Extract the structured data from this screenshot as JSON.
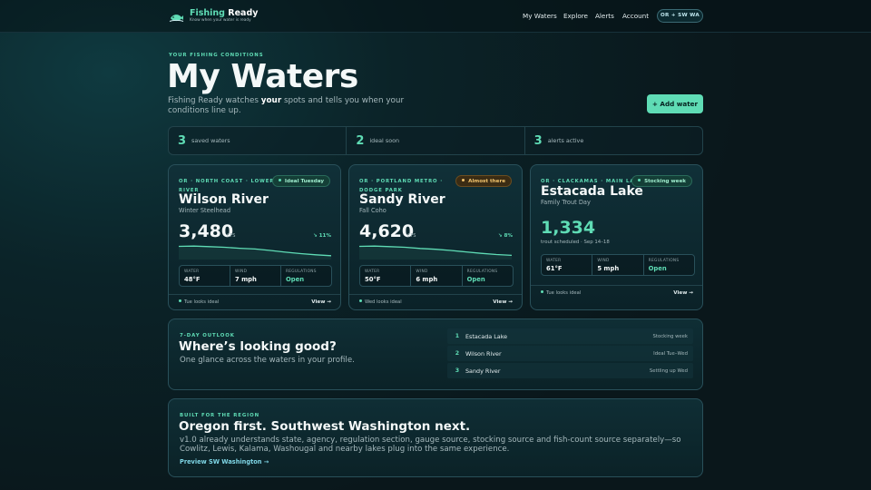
{
  "brand": {
    "name_a": "Fishing",
    "name_b": " Ready",
    "tagline": "Know when your water is ready",
    "icon": "fish-hook-logo"
  },
  "nav": {
    "items": [
      "My Waters",
      "Explore",
      "Alerts",
      "Account"
    ],
    "region_button": "OR + SW WA"
  },
  "hero": {
    "eyebrow": "YOUR FISHING CONDITIONS",
    "title": "My Waters",
    "sub_before": "Fishing Ready watches ",
    "sub_bold": "your",
    "sub_after": " spots and tells you when your conditions line up.",
    "add_button": "+ Add water"
  },
  "stats": [
    {
      "num": "3",
      "label": "saved waters"
    },
    {
      "num": "2",
      "label": "ideal soon"
    },
    {
      "num": "3",
      "label": "alerts active"
    }
  ],
  "cards": [
    {
      "location": "OR · NORTH COAST · LOWER RIVER",
      "badge": "Ideal Tuesday",
      "river": "Wilson River",
      "species": "Winter Steelhead",
      "flow": "3,480",
      "unit": "CFS",
      "change": "↘ 11%",
      "trend": [
        0.22,
        0.2,
        0.24,
        0.28,
        0.35,
        0.4,
        0.5,
        0.62,
        0.72,
        0.8,
        0.86
      ],
      "water_label": "WATER",
      "water": "48°F",
      "wind_label": "WIND",
      "wind": "7 mph",
      "reg_label": "REGULATIONS",
      "reg": "Open",
      "foot": "Tue looks ideal",
      "view": "View →"
    },
    {
      "location": "OR · PORTLAND METRO · DODGE PARK",
      "badge": "Almost there",
      "river": "Sandy River",
      "species": "Fall Coho",
      "flow": "4,620",
      "unit": "CFS",
      "change": "↘ 8%",
      "trend": [
        0.22,
        0.2,
        0.24,
        0.28,
        0.36,
        0.42,
        0.5,
        0.6,
        0.7,
        0.78,
        0.84
      ],
      "water_label": "WATER",
      "water": "50°F",
      "wind_label": "WIND",
      "wind": "6 mph",
      "reg_label": "REGULATIONS",
      "reg": "Open",
      "foot": "Wed looks ideal",
      "view": "View →"
    },
    {
      "location": "OR · CLACKAMAS · MAIN LAKE",
      "badge": "Stocking week",
      "river": "Estacada Lake",
      "species": "Family Trout Day",
      "count": "1,334",
      "schedule": "trout scheduled · Sep 14–18",
      "water_label": "WATER",
      "water": "61°F",
      "wind_label": "WIND",
      "wind": "5 mph",
      "reg_label": "REGULATIONS",
      "reg": "Open",
      "foot": "Tue looks ideal",
      "view": "View →"
    }
  ],
  "outlook": {
    "eyebrow": "7-DAY OUTLOOK",
    "title": "Where’s looking good?",
    "sub": "One glance across the waters in your profile.",
    "rows": [
      {
        "num": "1",
        "name": "Estacada Lake",
        "status": "Stocking week"
      },
      {
        "num": "2",
        "name": "Wilson River",
        "status": "Ideal Tue–Wed"
      },
      {
        "num": "3",
        "name": "Sandy River",
        "status": "Settling up Wed"
      }
    ]
  },
  "region": {
    "eyebrow": "BUILT FOR THE REGION",
    "title": "Oregon first. Southwest Washington next.",
    "sub": "v1.0 already understands state, agency, regulation section, gauge source, stocking source and fish-count source separately—so Cowlitz, Lewis, Kalama, Washougal and nearby lakes plug into the same experience.",
    "link": "Preview SW Washington →"
  },
  "colors": {
    "accent": "#5fdcb5",
    "amber": "#f2c46d",
    "background": "#0a171b"
  }
}
